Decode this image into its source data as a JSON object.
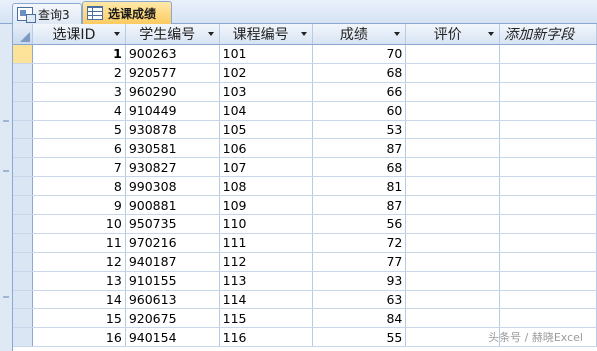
{
  "tabs": [
    {
      "label": "查询3",
      "active": false,
      "icon": "query-icon"
    },
    {
      "label": "选课成绩",
      "active": true,
      "icon": "table-icon"
    }
  ],
  "columns": [
    {
      "label": "选课ID",
      "dropdown": true
    },
    {
      "label": "学生编号",
      "dropdown": true
    },
    {
      "label": "课程编号",
      "dropdown": true
    },
    {
      "label": "成绩",
      "dropdown": true
    },
    {
      "label": "评价",
      "dropdown": true
    },
    {
      "label": "添加新字段",
      "dropdown": false
    }
  ],
  "rows": [
    {
      "id": "1",
      "student": "900263",
      "course": "101",
      "score": "70",
      "eval": ""
    },
    {
      "id": "2",
      "student": "920577",
      "course": "102",
      "score": "68",
      "eval": ""
    },
    {
      "id": "3",
      "student": "960290",
      "course": "103",
      "score": "66",
      "eval": ""
    },
    {
      "id": "4",
      "student": "910449",
      "course": "104",
      "score": "60",
      "eval": ""
    },
    {
      "id": "5",
      "student": "930878",
      "course": "105",
      "score": "53",
      "eval": ""
    },
    {
      "id": "6",
      "student": "930581",
      "course": "106",
      "score": "87",
      "eval": ""
    },
    {
      "id": "7",
      "student": "930827",
      "course": "107",
      "score": "68",
      "eval": ""
    },
    {
      "id": "8",
      "student": "990308",
      "course": "108",
      "score": "81",
      "eval": ""
    },
    {
      "id": "9",
      "student": "900881",
      "course": "109",
      "score": "87",
      "eval": ""
    },
    {
      "id": "10",
      "student": "950735",
      "course": "110",
      "score": "56",
      "eval": ""
    },
    {
      "id": "11",
      "student": "970216",
      "course": "111",
      "score": "72",
      "eval": ""
    },
    {
      "id": "12",
      "student": "940187",
      "course": "112",
      "score": "77",
      "eval": ""
    },
    {
      "id": "13",
      "student": "910155",
      "course": "113",
      "score": "93",
      "eval": ""
    },
    {
      "id": "14",
      "student": "960613",
      "course": "114",
      "score": "63",
      "eval": ""
    },
    {
      "id": "15",
      "student": "920675",
      "course": "115",
      "score": "84",
      "eval": ""
    },
    {
      "id": "16",
      "student": "940154",
      "course": "116",
      "score": "55",
      "eval": ""
    }
  ],
  "current_row_index": 0,
  "watermark": "头条号 / 赫晓Excel",
  "colors": {
    "accent_tab": "#fccb62",
    "header_bg": "#d8e4f3",
    "border": "#8ba9d0"
  }
}
